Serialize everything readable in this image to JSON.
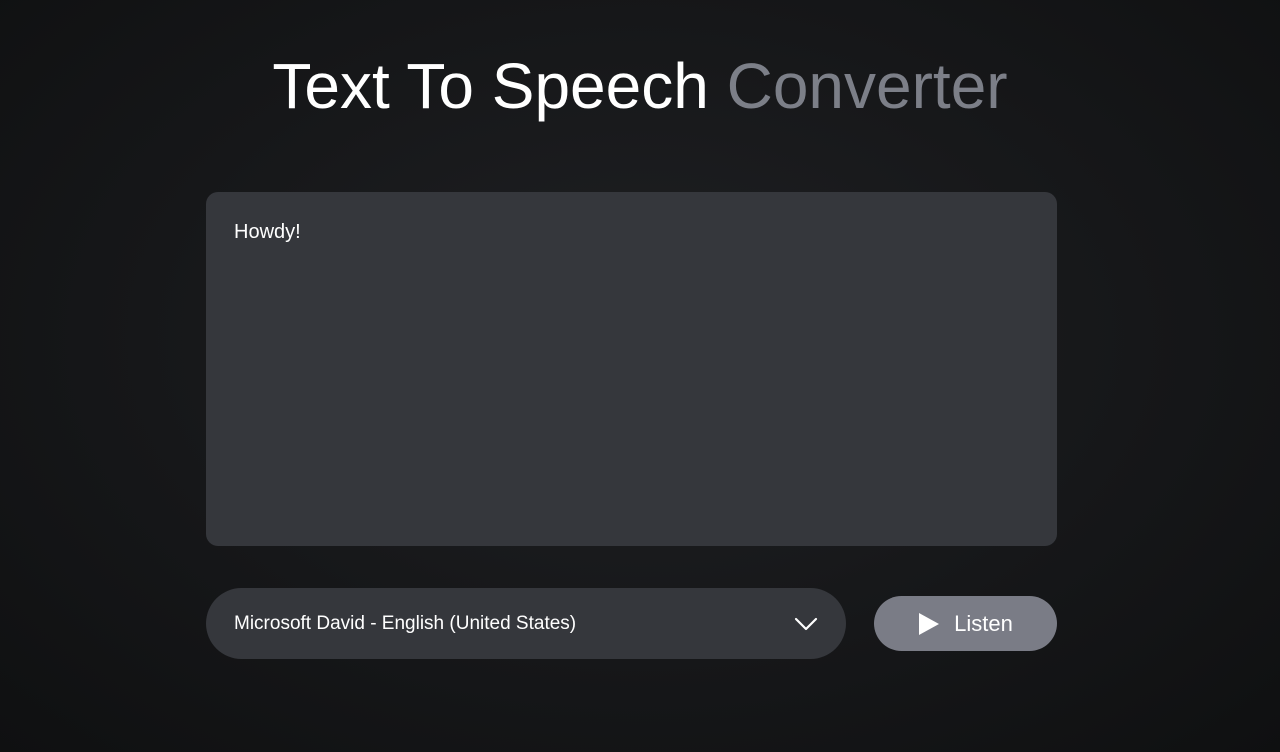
{
  "title": {
    "primary": "Text To Speech",
    "accent": "Converter"
  },
  "text_input": {
    "value": "Howdy!"
  },
  "voice_select": {
    "selected": "Microsoft David - English (United States)",
    "icon": "chevron-down-icon"
  },
  "listen_button": {
    "label": "Listen",
    "icon": "play-icon"
  },
  "colors": {
    "background": "#161719",
    "panel": "#35373c",
    "button": "#7a7c86",
    "accent_text": "#7c7f88",
    "text": "#ffffff"
  }
}
